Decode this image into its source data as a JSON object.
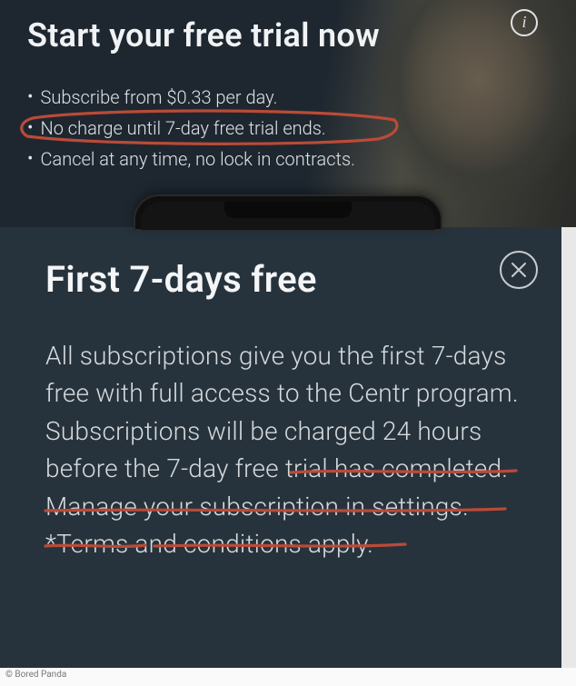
{
  "top": {
    "title": "Start your free trial now",
    "info_icon_label": "i",
    "bullets": [
      "Subscribe from $0.33 per day.",
      "No charge until 7-day free trial ends.",
      "Cancel at any time, no lock in contracts."
    ]
  },
  "bottom": {
    "title": "First 7-days free",
    "body": "All subscriptions give you the first 7-days free with full access to the Centr program. Subscriptions will be charged 24 hours before the 7-day free trial has completed. Manage your subscription in settings. *Terms and conditions apply."
  },
  "watermark": "© Bored Panda",
  "annotation_color": "#b94a3a"
}
